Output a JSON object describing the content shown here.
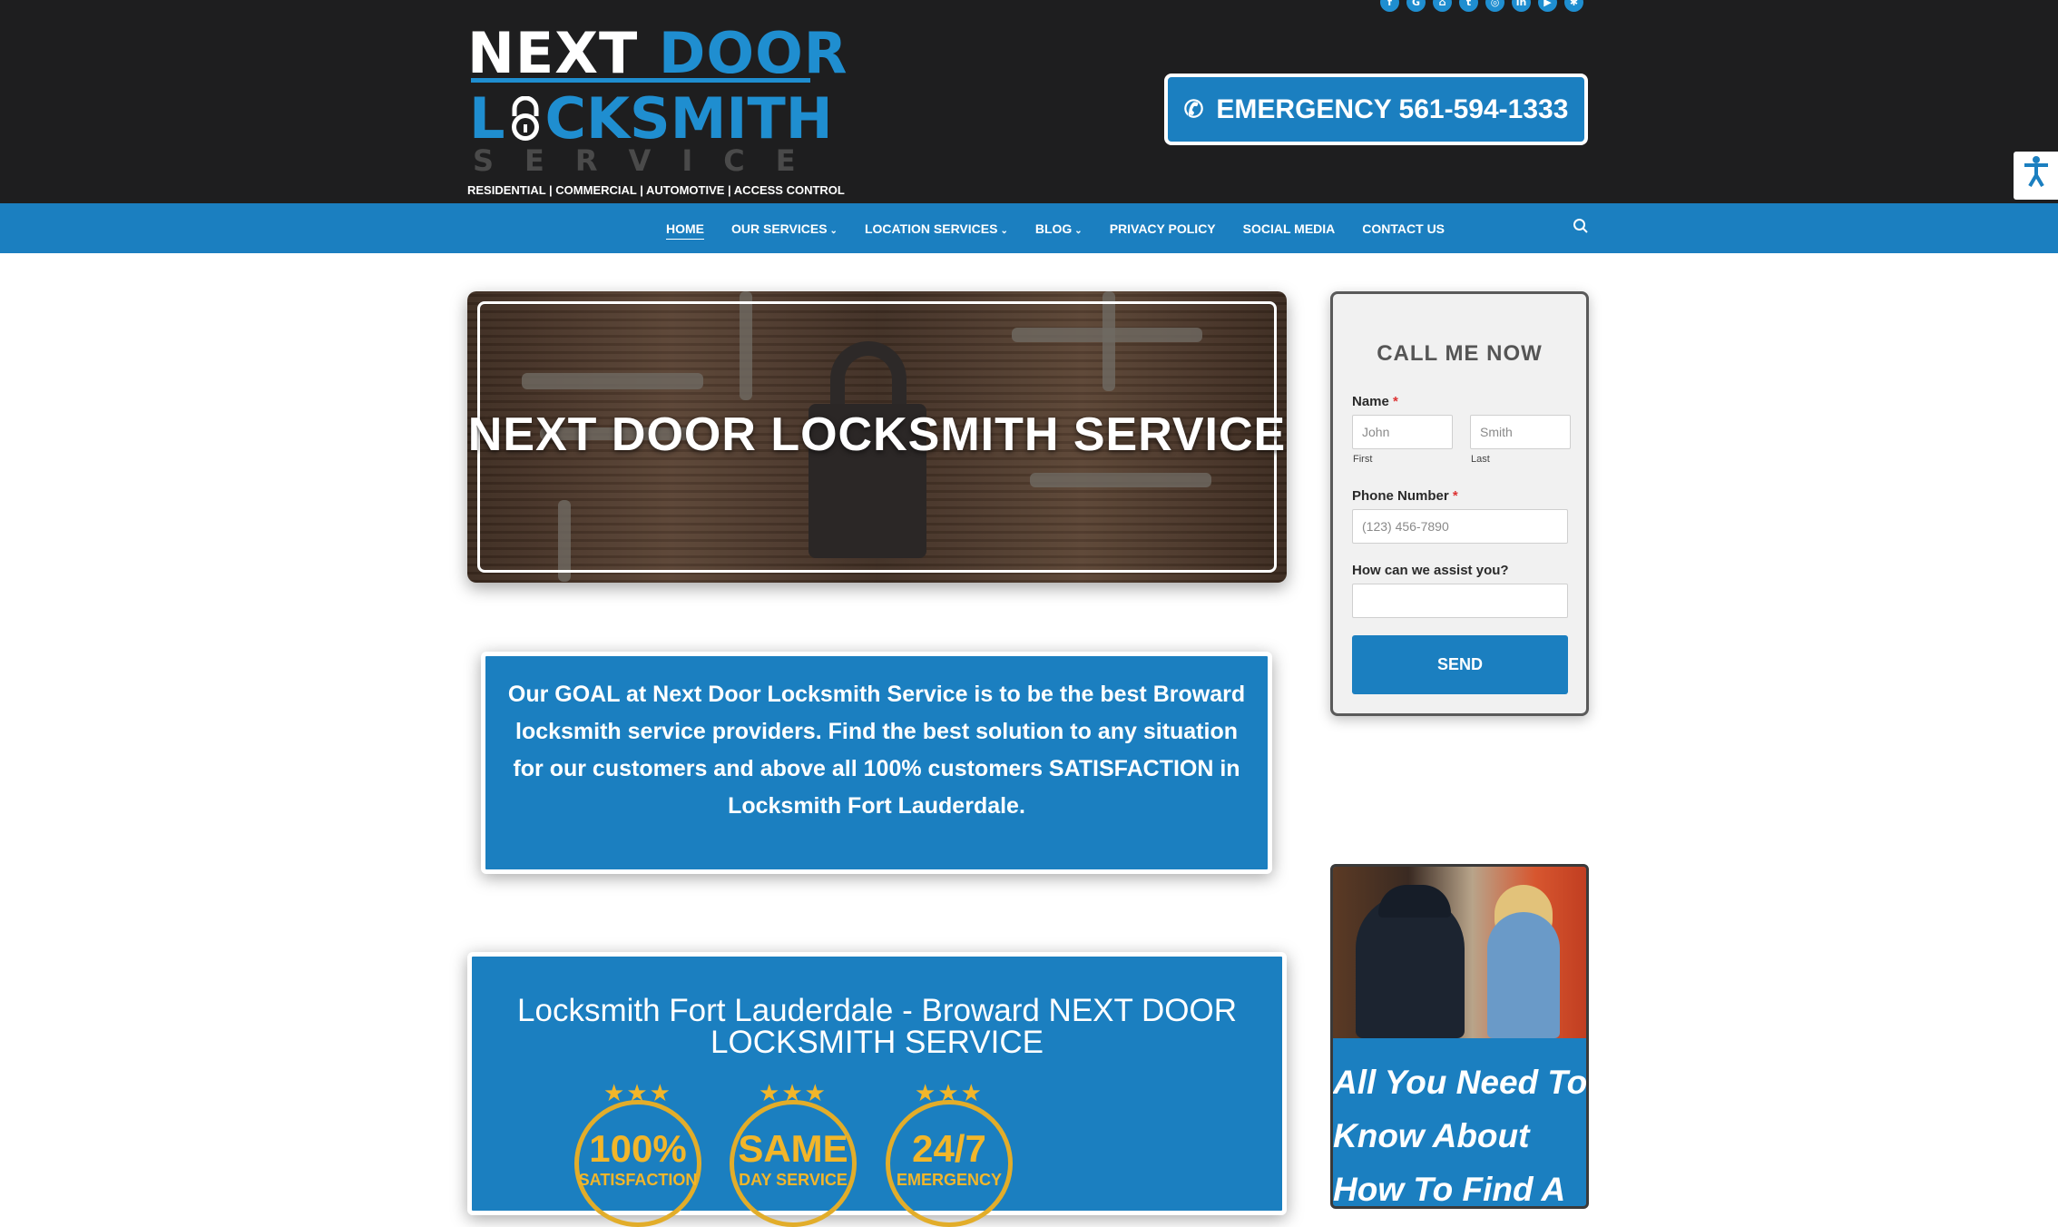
{
  "brand": {
    "line1_a": "NEXT ",
    "line1_b": "DOOR",
    "line2_a": "L",
    "line2_b": "CKSMITH",
    "line3": "SERVICE",
    "tagline": "RESIDENTIAL | COMMERCIAL | AUTOMOTIVE | ACCESS CONTROL"
  },
  "social_icons": [
    "facebook-icon",
    "google-icon",
    "home-icon",
    "twitter-icon",
    "instagram-icon",
    "linkedin-icon",
    "youtube-icon",
    "yelp-icon"
  ],
  "emergency": {
    "label": "EMERGENCY 561-594-1333"
  },
  "nav": {
    "items": [
      {
        "label": "HOME",
        "active": true,
        "dropdown": false
      },
      {
        "label": "OUR SERVICES",
        "active": false,
        "dropdown": true
      },
      {
        "label": "LOCATION SERVICES",
        "active": false,
        "dropdown": true
      },
      {
        "label": "BLOG",
        "active": false,
        "dropdown": true
      },
      {
        "label": "PRIVACY POLICY",
        "active": false,
        "dropdown": false
      },
      {
        "label": "SOCIAL MEDIA",
        "active": false,
        "dropdown": false
      },
      {
        "label": "CONTACT US",
        "active": false,
        "dropdown": false
      }
    ]
  },
  "hero": {
    "title": "NEXT DOOR LOCKSMITH SERVICE"
  },
  "goal": {
    "text": "Our GOAL at Next Door Locksmith Service is to be the best Broward locksmith service providers. Find the best solution to any situation for our customers and above all 100% customers SATISFACTION in Locksmith Fort Lauderdale."
  },
  "form": {
    "title": "CALL ME NOW",
    "name_label": "Name",
    "required_mark": "*",
    "first_placeholder": "John",
    "last_placeholder": "Smith",
    "first_sub": "First",
    "last_sub": "Last",
    "phone_label": "Phone Number",
    "phone_placeholder": "(123) 456-7890",
    "assist_label": "How can we assist you?",
    "assist_value": "",
    "send_label": "SEND"
  },
  "promo": {
    "caption": "All You Need To\nKnow About\nHow To Find A"
  },
  "about": {
    "title": "Locksmith Fort Lauderdale - Broward NEXT DOOR LOCKSMITH SERVICE",
    "badges": [
      {
        "big": "100%",
        "small": "SATISFACTION"
      },
      {
        "big": "SAME",
        "small": "DAY SERVICE"
      },
      {
        "big": "24/7",
        "small": "EMERGENCY"
      }
    ]
  },
  "colors": {
    "brand_blue": "#1b7fc0",
    "dark_header": "#1e1e1f",
    "gold": "#f2b62a"
  }
}
